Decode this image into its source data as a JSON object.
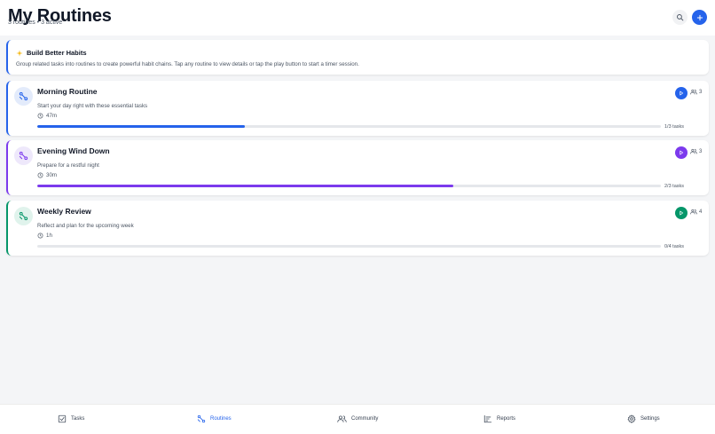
{
  "header": {
    "title": "My Routines",
    "subtitle": "3 routines • 3 active",
    "search_icon": "search-icon",
    "add_icon": "plus-icon",
    "accent": "#2563eb"
  },
  "tip": {
    "icon": "sparkle-icon",
    "title": "Build Better Habits",
    "body": "Group related tasks into routines to create powerful habit chains. Tap any routine to view details or tap the play button to start a timer session."
  },
  "routines": [
    {
      "name": "Morning Routine",
      "description": "Start your day right with these essential tasks",
      "duration": "47m",
      "people": "3",
      "progress": 0.333,
      "tasks_label": "1/3 tasks",
      "color": "#2563eb",
      "icon_bg": "#e3ebfb"
    },
    {
      "name": "Evening Wind Down",
      "description": "Prepare for a restful night",
      "duration": "30m",
      "people": "3",
      "progress": 0.667,
      "tasks_label": "2/3 tasks",
      "color": "#7c3aed",
      "icon_bg": "#eee8fb"
    },
    {
      "name": "Weekly Review",
      "description": "Reflect and plan for the upcoming week",
      "duration": "1h",
      "people": "4",
      "progress": 0,
      "tasks_label": "0/4 tasks",
      "color": "#059669",
      "icon_bg": "#e0f3ec"
    }
  ],
  "nav": [
    {
      "label": "Tasks",
      "icon": "checkbox-icon",
      "active": false
    },
    {
      "label": "Routines",
      "icon": "routine-icon",
      "active": true
    },
    {
      "label": "Community",
      "icon": "community-icon",
      "active": false
    },
    {
      "label": "Reports",
      "icon": "chart-icon",
      "active": false
    },
    {
      "label": "Settings",
      "icon": "gear-icon",
      "active": false
    }
  ]
}
